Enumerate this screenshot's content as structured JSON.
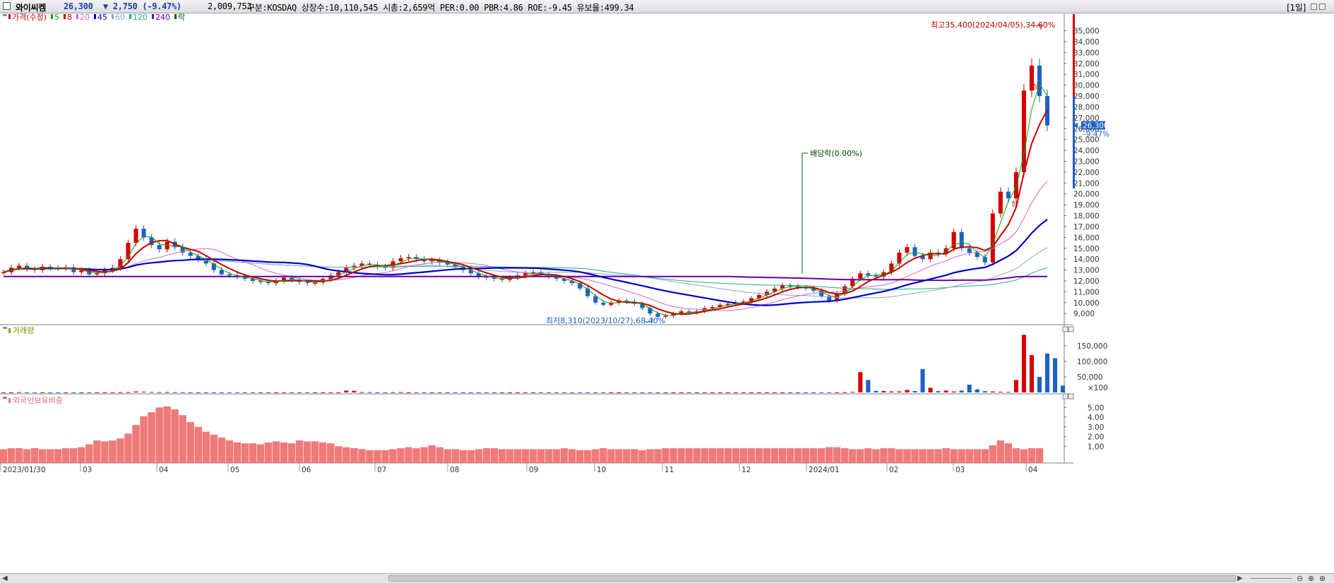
{
  "header": {
    "stock_name": "와이씨켐",
    "price": "26,300",
    "change": "▼ 2,750 (-9.47%)",
    "volume": "2,009,753",
    "info": "구분:KOSDAQ 상장수:10,110,545 시총:2,659억 PER:0.00 PBR:4.86 ROE:-9.45 유보율:499.34",
    "period": "[1일]"
  },
  "legend": [
    {
      "label": "가격(수정)",
      "color": "#cc0000"
    },
    {
      "label": "5",
      "color": "#00aa00"
    },
    {
      "label": "8",
      "color": "#cc0000"
    },
    {
      "label": "20",
      "color": "#cc66cc"
    },
    {
      "label": "45",
      "color": "#0000cc"
    },
    {
      "label": "60",
      "color": "#88aacc"
    },
    {
      "label": "120",
      "color": "#22aa88"
    },
    {
      "label": "240",
      "color": "#6600aa"
    },
    {
      "label": "락",
      "color": "#006600"
    }
  ],
  "volume_panel_title": "거래량",
  "foreign_panel_title": "외국인보유비중",
  "annotations": {
    "high": "최고35,400(2024/04/05),34.60%",
    "low": "최저8,310(2023/10/27),68.40%",
    "dividend": "배당락(0.00%)",
    "sang1": "상",
    "sang2": "상"
  },
  "price_badge": {
    "price": "26,300",
    "change": "-9.47%"
  },
  "chart_data": {
    "type": "candlestick",
    "price_axis_ticks": [
      "35,000",
      "34,000",
      "33,000",
      "32,000",
      "31,000",
      "30,000",
      "29,000",
      "28,000",
      "27,000",
      "26,000",
      "25,000",
      "24,000",
      "23,000",
      "22,000",
      "21,000",
      "20,000",
      "19,000",
      "18,000",
      "17,000",
      "16,000",
      "15,000",
      "14,000",
      "13,000",
      "12,000",
      "11,000",
      "10,000",
      "9,000"
    ],
    "volume_axis_ticks": [
      "150,000",
      "100,000",
      "50,000",
      "×100"
    ],
    "foreign_axis_ticks": [
      "5.00",
      "4.00",
      "3.00",
      "2.00",
      "1.00"
    ],
    "x_labels": [
      "2023/01/30",
      "03",
      "04",
      "05",
      "06",
      "07",
      "08",
      "09",
      "10",
      "11",
      "12",
      "2024/01",
      "02",
      "03",
      "04"
    ],
    "close_series": [
      12800,
      13200,
      13400,
      13100,
      13000,
      13300,
      13200,
      13150,
      13250,
      12800,
      13000,
      12600,
      12700,
      13000,
      13200,
      14000,
      15500,
      16800,
      16000,
      15300,
      14900,
      15600,
      15100,
      14600,
      14300,
      14000,
      13600,
      13000,
      12600,
      12500,
      12400,
      12200,
      12000,
      11900,
      11800,
      12000,
      12300,
      12100,
      11900,
      11800,
      11850,
      12200,
      12500,
      12800,
      13200,
      13400,
      13600,
      13500,
      13300,
      13200,
      13800,
      14100,
      14200,
      14000,
      13800,
      13900,
      13700,
      13500,
      13300,
      13000,
      12700,
      12400,
      12300,
      12200,
      12100,
      12300,
      12500,
      12700,
      12800,
      12600,
      12400,
      12200,
      12000,
      11800,
      11300,
      10600,
      10000,
      9800,
      10000,
      10200,
      10100,
      9900,
      9500,
      9000,
      8700,
      8800,
      9000,
      9200,
      9100,
      9200,
      9500,
      9600,
      9800,
      9900,
      10000,
      10100,
      10400,
      10700,
      11000,
      11300,
      11600,
      11500,
      11400,
      11300,
      11100,
      10600,
      10200,
      10800,
      11500,
      12200,
      12700,
      12500,
      12400,
      12800,
      13600,
      14600,
      15100,
      14300,
      14000,
      14600,
      14500,
      15000,
      16500,
      15000,
      14600,
      14200,
      13700,
      18200,
      20200,
      19600,
      22000,
      29500,
      31800,
      29000,
      26300
    ],
    "volume_series": [
      600,
      500,
      800,
      500,
      500,
      400,
      300,
      400,
      400,
      500,
      400,
      300,
      400,
      700,
      500,
      800,
      1200,
      3000,
      2500,
      1500,
      900,
      1200,
      700,
      600,
      400,
      400,
      300,
      300,
      300,
      300,
      300,
      300,
      200,
      200,
      200,
      200,
      300,
      300,
      200,
      200,
      200,
      300,
      300,
      300,
      6000,
      5000,
      1200,
      800,
      400,
      300,
      900,
      1000,
      700,
      600,
      400,
      400,
      300,
      300,
      300,
      300,
      200,
      200,
      200,
      200,
      200,
      200,
      300,
      300,
      300,
      200,
      200,
      200,
      200,
      200,
      400,
      300,
      200,
      200,
      200,
      200,
      200,
      200,
      200,
      200,
      300,
      200,
      200,
      200,
      200,
      200,
      200,
      200,
      200,
      200,
      200,
      200,
      300,
      300,
      300,
      300,
      300,
      200,
      200,
      200,
      200,
      300,
      300,
      400,
      800,
      2000,
      65000,
      40000,
      5000,
      4500,
      3000,
      3000,
      8000,
      4500,
      75000,
      15000,
      4000,
      6000,
      3000,
      6000,
      25000,
      10000,
      4000,
      3000,
      2000,
      2000,
      40000,
      185000,
      120000,
      50000,
      125000,
      110000,
      22000
    ],
    "foreign_series": [
      0.7,
      0.8,
      0.8,
      0.7,
      0.8,
      0.7,
      0.7,
      0.7,
      0.8,
      0.8,
      0.9,
      1.2,
      1.6,
      1.5,
      1.6,
      1.8,
      2.3,
      3.2,
      4.1,
      4.5,
      5.0,
      5.1,
      4.8,
      4.2,
      3.5,
      3.0,
      2.5,
      2.2,
      1.9,
      1.6,
      1.4,
      1.3,
      1.3,
      1.2,
      1.4,
      1.5,
      1.4,
      1.3,
      1.6,
      1.5,
      1.5,
      1.4,
      1.3,
      1.0,
      0.9,
      0.8,
      0.7,
      0.6,
      0.6,
      0.6,
      0.7,
      0.8,
      0.9,
      0.8,
      0.9,
      1.1,
      0.9,
      0.7,
      0.7,
      0.6,
      0.6,
      0.7,
      0.8,
      0.8,
      0.7,
      0.7,
      0.7,
      0.7,
      0.7,
      0.7,
      0.7,
      0.7,
      0.8,
      0.7,
      0.6,
      0.6,
      0.7,
      0.8,
      0.7,
      0.7,
      0.7,
      0.7,
      0.6,
      0.7,
      0.7,
      0.8,
      0.8,
      0.8,
      0.8,
      0.8,
      0.8,
      0.8,
      0.8,
      0.8,
      0.8,
      0.8,
      0.8,
      0.8,
      0.8,
      0.8,
      0.8,
      0.8,
      0.8,
      0.8,
      0.8,
      0.8,
      0.9,
      0.9,
      0.8,
      0.7,
      0.7,
      0.8,
      0.7,
      0.8,
      0.8,
      0.7,
      0.7,
      0.7,
      0.7,
      0.7,
      0.7,
      0.8,
      0.7,
      0.7,
      0.7,
      0.7,
      0.7,
      1.1,
      1.6,
      1.3,
      0.8,
      0.7,
      0.8,
      0.8
    ]
  },
  "colors": {
    "up": "#d40000",
    "down": "#1f5fc8",
    "ma5": "#00aa00",
    "ma8": "#cc0000",
    "ma20": "#cc66cc",
    "ma45": "#0000cc",
    "ma60": "#88aacc",
    "ma120": "#22aa88",
    "ma240": "#6600aa",
    "foreign_bar": "#f07a7a",
    "dividend_line": "#006600"
  }
}
